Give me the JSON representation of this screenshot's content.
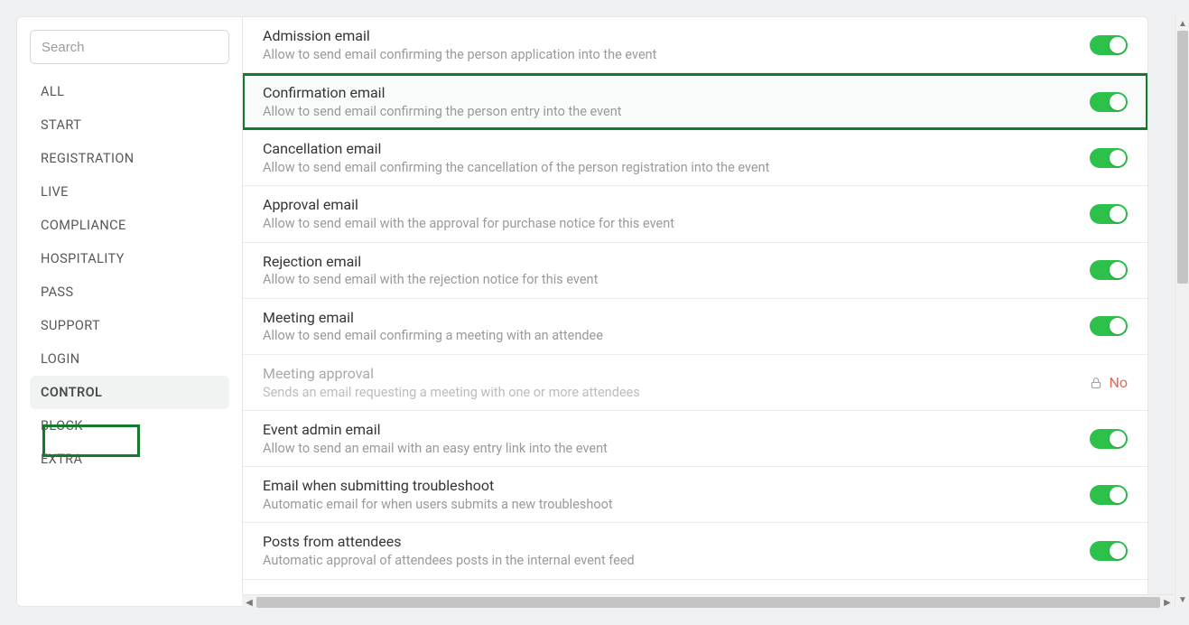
{
  "search": {
    "placeholder": "Search"
  },
  "sidebar": {
    "items": [
      {
        "label": "ALL"
      },
      {
        "label": "START"
      },
      {
        "label": "REGISTRATION"
      },
      {
        "label": "LIVE"
      },
      {
        "label": "COMPLIANCE"
      },
      {
        "label": "HOSPITALITY"
      },
      {
        "label": "PASS"
      },
      {
        "label": "SUPPORT"
      },
      {
        "label": "LOGIN"
      },
      {
        "label": "CONTROL",
        "active": true
      },
      {
        "label": "BLOCK"
      },
      {
        "label": "EXTRA"
      }
    ]
  },
  "settings": [
    {
      "title": "Admission email",
      "desc": "Allow to send email confirming the person application into the event",
      "state": "on"
    },
    {
      "title": "Confirmation email",
      "desc": "Allow to send email confirming the person entry into the event",
      "state": "on",
      "highlighted": true
    },
    {
      "title": "Cancellation email",
      "desc": "Allow to send email confirming the cancellation of the person registration into the event",
      "state": "on"
    },
    {
      "title": "Approval email",
      "desc": "Allow to send email with the approval for purchase notice for this event",
      "state": "on"
    },
    {
      "title": "Rejection email",
      "desc": "Allow to send email with the rejection notice for this event",
      "state": "on"
    },
    {
      "title": "Meeting email",
      "desc": "Allow to send email confirming a meeting with an attendee",
      "state": "on"
    },
    {
      "title": "Meeting approval",
      "desc": "Sends an email requesting a meeting with one or more attendees",
      "state": "locked",
      "lock_text": "No",
      "disabled": true
    },
    {
      "title": "Event admin email",
      "desc": "Allow to send an email with an easy entry link into the event",
      "state": "on"
    },
    {
      "title": "Email when submitting troubleshoot",
      "desc": "Automatic email for when users submits a new troubleshoot",
      "state": "on"
    },
    {
      "title": "Posts from attendees",
      "desc": "Automatic approval of attendees posts in the internal event feed",
      "state": "on"
    }
  ],
  "colors": {
    "accent": "#2dc14b",
    "highlight": "#157a2e",
    "lock_text": "#e06a5a"
  }
}
